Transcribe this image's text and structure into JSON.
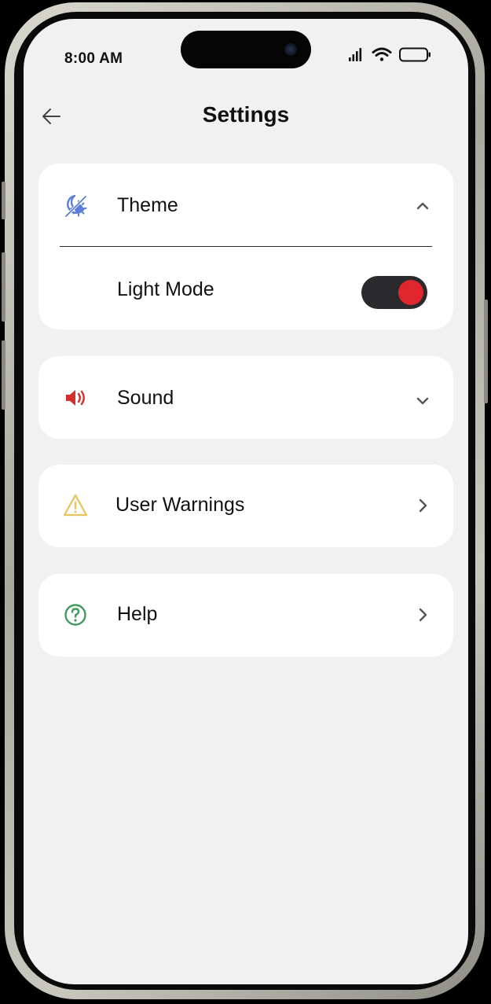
{
  "status_bar": {
    "time": "8:00 AM",
    "signal_icon": "cellular-signal-icon",
    "wifi_icon": "wifi-icon",
    "battery_icon": "battery-icon"
  },
  "header": {
    "title": "Settings",
    "back_icon": "arrow-left-icon"
  },
  "theme": {
    "label": "Theme",
    "icon": "day-night-icon",
    "icon_color": "#5b7fd6",
    "expanded": true,
    "chevron_icon": "chevron-up-icon",
    "light_mode": {
      "label": "Light Mode",
      "toggle_on": true,
      "toggle_track_color": "#2a2a2c",
      "toggle_knob_color": "#e0262d"
    }
  },
  "sound": {
    "label": "Sound",
    "icon": "speaker-icon",
    "icon_color": "#d32f2f",
    "chevron_icon": "chevron-down-icon"
  },
  "user_warnings": {
    "label": "User Warnings",
    "icon": "warning-triangle-icon",
    "icon_color": "#e8c25a",
    "chevron_icon": "chevron-right-icon"
  },
  "help": {
    "label": "Help",
    "icon": "question-circle-icon",
    "icon_color": "#3f9a5e",
    "chevron_icon": "chevron-right-icon"
  }
}
